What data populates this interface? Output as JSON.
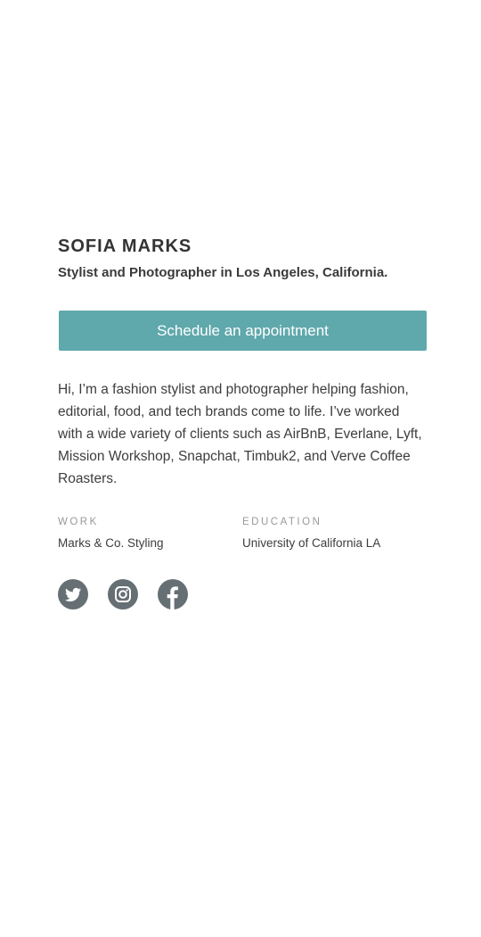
{
  "profile": {
    "name": "SOFIA MARKS",
    "tagline": "Stylist and Photographer in Los Angeles, California.",
    "cta_label": "Schedule an appointment",
    "bio": "Hi, I’m a fashion stylist and photographer helping fashion, editorial, food, and tech brands come to life. I’ve worked with a wide variety of clients such as AirBnB, Everlane, Lyft, Mission Workshop, Snapchat, Timbuk2, and Verve Coffee Roasters."
  },
  "meta": {
    "work_label": "WORK",
    "work_value": "Marks & Co. Styling",
    "education_label": "EDUCATION",
    "education_value": "University of California LA"
  },
  "social": {
    "icons": [
      "twitter-icon",
      "instagram-icon",
      "facebook-icon"
    ],
    "icon_color": "#666f73"
  },
  "colors": {
    "accent": "#5fa8ac",
    "text": "#333333",
    "muted": "#999999"
  }
}
